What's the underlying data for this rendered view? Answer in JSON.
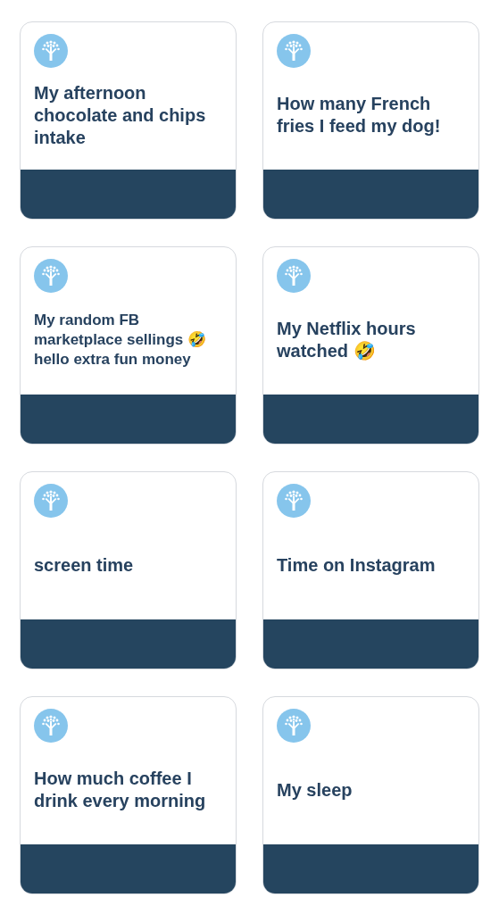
{
  "cards": [
    {
      "title": "My afternoon chocolate and chips intake"
    },
    {
      "title": "How many French fries I feed my dog!"
    },
    {
      "title": "My random FB marketplace sellings 🤣 hello extra fun money"
    },
    {
      "title": "My Netflix hours watched 🤣"
    },
    {
      "title": "screen time"
    },
    {
      "title": "Time on Instagram"
    },
    {
      "title": "How much coffee I drink every morning"
    },
    {
      "title": "My sleep"
    }
  ]
}
